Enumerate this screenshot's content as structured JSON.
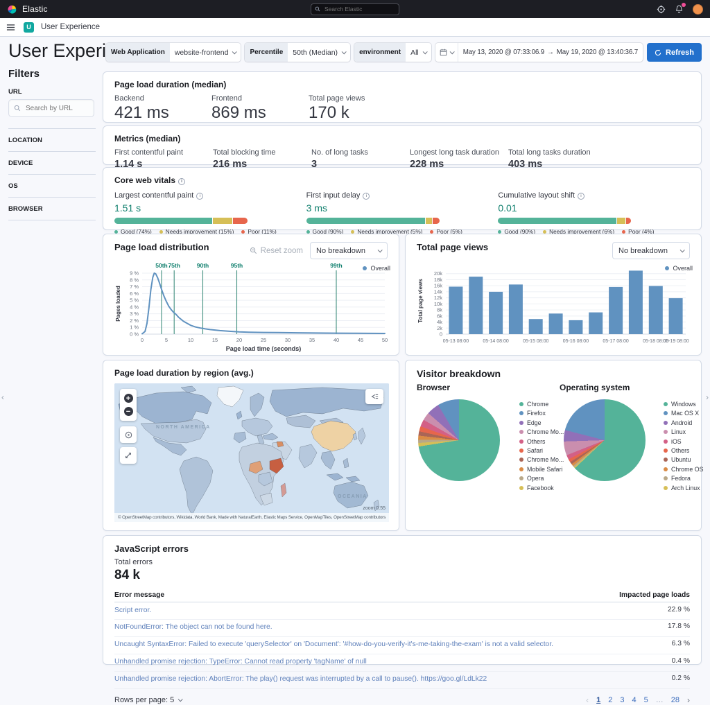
{
  "topbar": {
    "brand": "Elastic",
    "search_placeholder": "Search Elastic"
  },
  "breadcrumb_bar": {
    "app_initial": "U",
    "breadcrumb": "User Experience"
  },
  "page": {
    "title": "User Experience"
  },
  "filter_bar": {
    "service_label": "Web Application",
    "service_value": "website-frontend",
    "percentile_label": "Percentile",
    "percentile_value": "50th (Median)",
    "environment_label": "environment",
    "environment_value": "All",
    "date_start": "May 13, 2020 @ 07:33:06.9",
    "date_arrow": "→",
    "date_end": "May 19, 2020 @ 13:40:36.7",
    "refresh_label": "Refresh"
  },
  "sidebar": {
    "title": "Filters",
    "url_label": "URL",
    "url_placeholder": "Search by URL",
    "sections": [
      {
        "label": "LOCATION"
      },
      {
        "label": "DEVICE"
      },
      {
        "label": "OS"
      },
      {
        "label": "BROWSER"
      }
    ]
  },
  "duration_panel": {
    "title": "Page load duration (median)",
    "stats": [
      {
        "label": "Backend",
        "value": "421 ms"
      },
      {
        "label": "Frontend",
        "value": "869 ms"
      },
      {
        "label": "Total page views",
        "value": "170 k"
      }
    ]
  },
  "metrics_panel": {
    "title": "Metrics (median)",
    "stats": [
      {
        "label": "First contentful paint",
        "value": "1.14 s"
      },
      {
        "label": "Total blocking time",
        "value": "216 ms"
      },
      {
        "label": "No. of long tasks",
        "value": "3"
      },
      {
        "label": "Longest long task duration",
        "value": "228 ms"
      },
      {
        "label": "Total long tasks duration",
        "value": "403 ms"
      }
    ]
  },
  "core_web_vitals": {
    "title": "Core web vitals",
    "segment_colors": [
      "#54B399",
      "#D6BF57",
      "#E7664C"
    ],
    "vitals": [
      {
        "label": "Largest contentful paint",
        "value": "1.51 s",
        "segments": [
          74,
          15,
          11
        ],
        "legend": [
          "Good (74%)",
          "Needs improvement (15%)",
          "Poor (11%)"
        ]
      },
      {
        "label": "First input delay",
        "value": "3 ms",
        "segments": [
          90,
          5,
          5
        ],
        "legend": [
          "Good (90%)",
          "Needs improvement (5%)",
          "Poor (5%)"
        ]
      },
      {
        "label": "Cumulative layout shift",
        "value": "0.01",
        "segments": [
          90,
          6,
          4
        ],
        "legend": [
          "Good (90%)",
          "Needs improvement (6%)",
          "Poor (4%)"
        ]
      }
    ]
  },
  "distribution_panel": {
    "title": "Page load distribution",
    "reset_zoom_label": "Reset zoom",
    "breakdown_value": "No breakdown",
    "legend": "Overall"
  },
  "page_views_panel": {
    "title": "Total page views",
    "breakdown_value": "No breakdown",
    "legend": "Overall"
  },
  "map_panel": {
    "title": "Page load duration by region (avg.)",
    "labels": [
      "NORTH AMERICA",
      "OCEANIA"
    ],
    "zoom_label": "zoom 0.55",
    "attribution": "© OpenStreetMap contributors, Wikidata, World Bank, Made with NaturalEarth, Elastic Maps Service, OpenMapTiles, OpenStreetMap contributors"
  },
  "visitor_panel": {
    "title": "Visitor breakdown",
    "browser_title": "Browser",
    "os_title": "Operating system"
  },
  "js_errors_panel": {
    "title": "JavaScript errors",
    "total_label": "Total errors",
    "total_value": "84 k",
    "col_message": "Error message",
    "col_impact": "Impacted page loads",
    "rows": [
      {
        "message": "Script error.",
        "impact": "22.9 %"
      },
      {
        "message": "NotFoundError: The object can not be found here.",
        "impact": "17.8 %"
      },
      {
        "message": "Uncaught SyntaxError: Failed to execute 'querySelector' on 'Document': '#how-do-you-verify-it's-me-taking-the-exam' is not a valid selector.",
        "impact": "6.3 %"
      },
      {
        "message": "Unhandled promise rejection: TypeError: Cannot read property 'tagName' of null",
        "impact": "0.4 %"
      },
      {
        "message": "Unhandled promise rejection: AbortError: The play() request was interrupted by a call to pause(). https://goo.gl/LdLk22",
        "impact": "0.2 %"
      }
    ],
    "rows_per_page_label": "Rows per page: 5",
    "pagination": {
      "prev": "‹",
      "pages": [
        "1",
        "2",
        "3",
        "4",
        "5",
        "…",
        "28"
      ],
      "active": "1",
      "next": "›"
    }
  },
  "chart_data": [
    {
      "id": "page_load_distribution",
      "type": "line",
      "title": "Page load distribution",
      "xlabel": "Page load time (seconds)",
      "ylabel": "Pages loaded",
      "xlim": [
        0,
        50
      ],
      "ylim": [
        0,
        9
      ],
      "x_ticks": [
        0,
        5,
        10,
        15,
        20,
        25,
        30,
        35,
        40,
        45,
        50
      ],
      "y_tick_labels": [
        "0 %",
        "1 %",
        "2 %",
        "3 %",
        "4 %",
        "5 %",
        "6 %",
        "7 %",
        "8 %",
        "9 %"
      ],
      "legend": [
        "Overall"
      ],
      "line_color": "#6092C0",
      "marker_color": "#3F8E7E",
      "marker_label_color": "#0f7f6d",
      "percentile_markers": [
        {
          "label": "50th",
          "x": 4
        },
        {
          "label": "75th",
          "x": 6.6
        },
        {
          "label": "90th",
          "x": 12.5
        },
        {
          "label": "95th",
          "x": 19.5
        },
        {
          "label": "99th",
          "x": 40
        }
      ],
      "points": [
        [
          0,
          0.05
        ],
        [
          0.6,
          0.4
        ],
        [
          1,
          1.6
        ],
        [
          1.4,
          3.9
        ],
        [
          1.8,
          6.6
        ],
        [
          2.2,
          8.4
        ],
        [
          2.5,
          9
        ],
        [
          2.8,
          8.9
        ],
        [
          3.2,
          8.3
        ],
        [
          3.6,
          7.5
        ],
        [
          4,
          6.6
        ],
        [
          4.5,
          5.6
        ],
        [
          5,
          4.8
        ],
        [
          5.5,
          4.1
        ],
        [
          6,
          3.6
        ],
        [
          6.5,
          3.2
        ],
        [
          7,
          2.9
        ],
        [
          7.5,
          2.5
        ],
        [
          8,
          2.2
        ],
        [
          8.5,
          1.9
        ],
        [
          9,
          1.7
        ],
        [
          10,
          1.3
        ],
        [
          11,
          1.05
        ],
        [
          12,
          0.9
        ],
        [
          13,
          0.78
        ],
        [
          14,
          0.68
        ],
        [
          15,
          0.6
        ],
        [
          16,
          0.52
        ],
        [
          18,
          0.42
        ],
        [
          20,
          0.33
        ],
        [
          22,
          0.28
        ],
        [
          25,
          0.25
        ],
        [
          28,
          0.22
        ],
        [
          32,
          0.19
        ],
        [
          36,
          0.16
        ],
        [
          40,
          0.14
        ],
        [
          44,
          0.12
        ],
        [
          47,
          0.11
        ],
        [
          50,
          0.1
        ]
      ]
    },
    {
      "id": "total_page_views",
      "type": "bar",
      "title": "Total page views",
      "ylabel": "Total page views",
      "ylim": [
        0,
        22000
      ],
      "y_ticks": [
        {
          "v": 0,
          "label": "0"
        },
        {
          "v": 2000,
          "label": "2k"
        },
        {
          "v": 4000,
          "label": "4k"
        },
        {
          "v": 6000,
          "label": "6k"
        },
        {
          "v": 8000,
          "label": "8k"
        },
        {
          "v": 10000,
          "label": "10k"
        },
        {
          "v": 12000,
          "label": "12k"
        },
        {
          "v": 14000,
          "label": "14k"
        },
        {
          "v": 16000,
          "label": "16k"
        },
        {
          "v": 18000,
          "label": "18k"
        },
        {
          "v": 20000,
          "label": "20k"
        }
      ],
      "x_labels": [
        "05-13 08:00",
        "05-14 08:00",
        "05-15 08:00",
        "05-16 08:00",
        "05-17 08:00",
        "05-18 08:00",
        "05-19 08:00"
      ],
      "values": [
        15700,
        19000,
        14000,
        16400,
        5000,
        6800,
        4600,
        7200,
        15600,
        21000,
        15900,
        11900
      ],
      "bar_color": "#6092C0",
      "legend": [
        "Overall"
      ]
    },
    {
      "id": "browser_breakdown",
      "type": "pie",
      "title": "Browser",
      "labels": [
        "Chrome",
        "Firefox",
        "Edge",
        "Chrome Mo...",
        "Others",
        "Safari",
        "Chrome Mo...",
        "Mobile Safari",
        "Opera",
        "Facebook"
      ],
      "values": [
        72.5,
        8.5,
        5,
        3.2,
        2.8,
        2,
        1.7,
        1.6,
        1.3,
        1.4
      ],
      "colors": [
        "#54B399",
        "#6092C0",
        "#9170B8",
        "#CA8EAE",
        "#D36086",
        "#E7664C",
        "#AA6556",
        "#DA8B45",
        "#B9A888",
        "#D6BF57"
      ]
    },
    {
      "id": "os_breakdown",
      "type": "pie",
      "title": "Operating system",
      "labels": [
        "Windows",
        "Mac OS X",
        "Android",
        "Linux",
        "iOS",
        "Others",
        "Ubuntu",
        "Chrome OS",
        "Fedora",
        "Arch Linux"
      ],
      "values": [
        63,
        21,
        4.5,
        5.5,
        1.8,
        1.2,
        1,
        0.9,
        0.6,
        0.5
      ],
      "colors": [
        "#54B399",
        "#6092C0",
        "#9170B8",
        "#CA8EAE",
        "#D36086",
        "#E7664C",
        "#AA6556",
        "#DA8B45",
        "#B9A888",
        "#D6BF57"
      ]
    }
  ]
}
